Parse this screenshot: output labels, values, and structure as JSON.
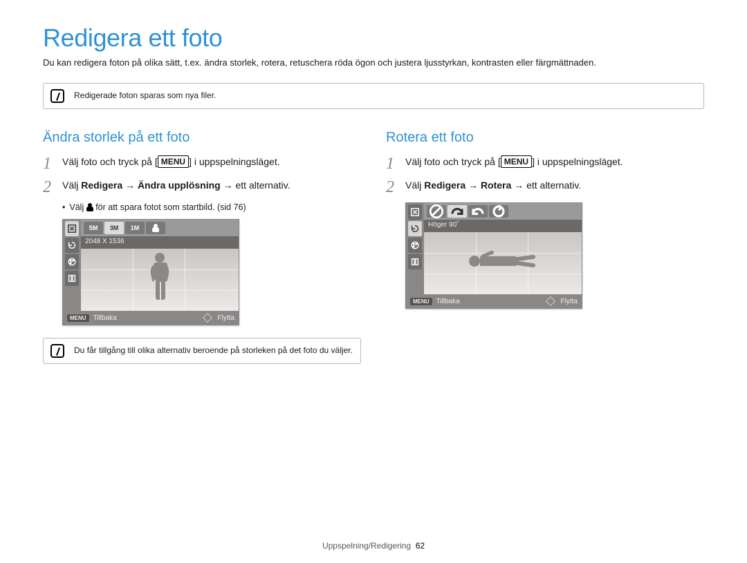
{
  "header": {
    "title": "Redigera ett foto",
    "intro": "Du kan redigera foton på olika sätt, t.ex. ändra storlek, rotera, retuschera röda ögon och justera ljusstyrkan, kontrasten eller färgmättnaden."
  },
  "note_top": "Redigerade foton sparas som nya filer.",
  "left": {
    "heading": "Ändra storlek på ett foto",
    "step1a": "Välj foto och tryck på [",
    "step1_menu": "MENU",
    "step1b": "] i uppspelningsläget.",
    "step2_pre": "Välj ",
    "step2_b1": "Redigera",
    "step2_arrow": " → ",
    "step2_b2": "Ändra upplösning",
    "step2_post": " → ett alternativ.",
    "bullet_pre": "Välj ",
    "bullet_post": " för att spara fotot som startbild. (sid 76)",
    "screenshot": {
      "opts": [
        "5M",
        "3M",
        "1M",
        ""
      ],
      "caption": "2048 X 1536",
      "back_label_key": "MENU",
      "back_label": "Tillbaka",
      "move_label": "Flytta"
    },
    "note_bottom": "Du får tillgång till olika alternativ beroende på storleken på det foto du väljer."
  },
  "right": {
    "heading": "Rotera ett foto",
    "step1a": "Välj foto och tryck på [",
    "step1_menu": "MENU",
    "step1b": "] i uppspelningsläget.",
    "step2_pre": "Välj ",
    "step2_b1": "Redigera",
    "step2_arrow": " → ",
    "step2_b2": "Rotera",
    "step2_post": " → ett alternativ.",
    "screenshot": {
      "caption": "Höger 90˚",
      "back_label_key": "MENU",
      "back_label": "Tillbaka",
      "move_label": "Flytta"
    }
  },
  "footer": {
    "section": "Uppspelning/Redigering",
    "page": "62"
  }
}
